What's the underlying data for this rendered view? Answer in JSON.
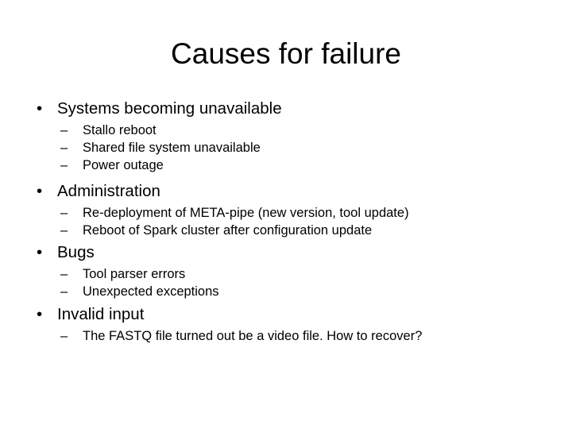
{
  "slide": {
    "title": "Causes for failure",
    "bullet_marker": "•",
    "sub_marker": "–",
    "groups": [
      {
        "heading": "Systems becoming unavailable",
        "items": [
          "Stallo reboot",
          "Shared file system unavailable",
          "Power outage"
        ]
      },
      {
        "heading": "Administration",
        "items": [
          "Re-deployment of META-pipe (new version, tool update)",
          "Reboot of Spark cluster after configuration update"
        ]
      },
      {
        "heading": "Bugs",
        "items": [
          "Tool parser errors",
          "Unexpected exceptions"
        ]
      },
      {
        "heading": "Invalid input",
        "items": [
          "The FASTQ file turned out be a video file. How to recover?"
        ]
      }
    ]
  },
  "colors": {
    "background": "#ffffff",
    "text": "#000000"
  }
}
